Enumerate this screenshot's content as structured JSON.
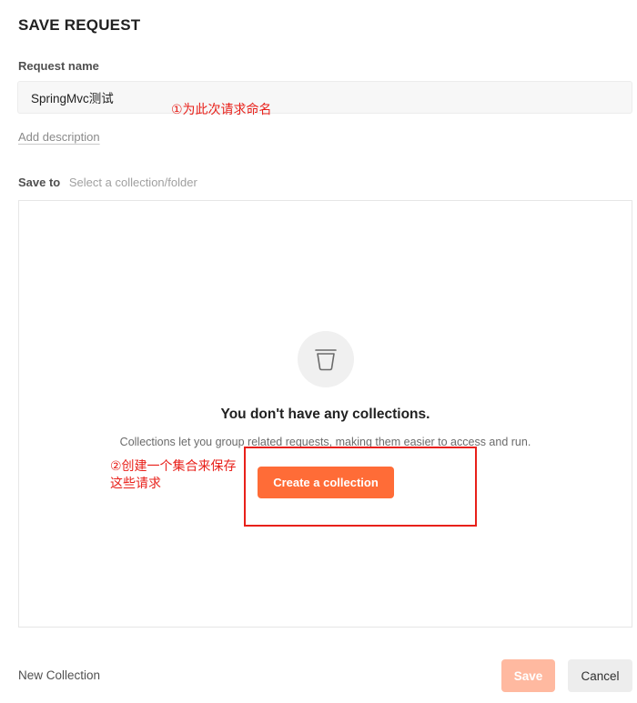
{
  "dialog": {
    "title": "SAVE REQUEST"
  },
  "request_name": {
    "label": "Request name",
    "value": "SpringMvc测试"
  },
  "add_description": "Add description",
  "save_to": {
    "label": "Save to",
    "path_placeholder": "Select a collection/folder"
  },
  "empty_state": {
    "icon": "trash-icon",
    "heading": "You don't have any collections.",
    "description": "Collections let you group related requests, making them easier to access and run.",
    "create_button": "Create a collection"
  },
  "annotations": {
    "step1": "①为此次请求命名",
    "step2": "②创建一个集合来保存这些请求",
    "highlight_color": "#e8201a"
  },
  "footer": {
    "new_collection": "New Collection",
    "save": "Save",
    "cancel": "Cancel"
  },
  "colors": {
    "accent": "#ff6c37",
    "accent_disabled": "#ffb9a0"
  }
}
